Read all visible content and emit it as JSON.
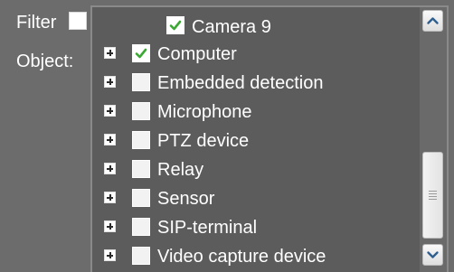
{
  "filter": {
    "label": "Filter",
    "checked": false
  },
  "object": {
    "label": "Object:"
  },
  "tree": {
    "items": [
      {
        "label": "Camera 9",
        "checked": true,
        "expandable": false
      },
      {
        "label": "Computer",
        "checked": true,
        "expandable": true
      },
      {
        "label": "Embedded detection",
        "checked": false,
        "expandable": true
      },
      {
        "label": "Microphone",
        "checked": false,
        "expandable": true
      },
      {
        "label": "PTZ device",
        "checked": false,
        "expandable": true
      },
      {
        "label": "Relay",
        "checked": false,
        "expandable": true
      },
      {
        "label": "Sensor",
        "checked": false,
        "expandable": true
      },
      {
        "label": "SIP-terminal",
        "checked": false,
        "expandable": true
      },
      {
        "label": "Video capture device",
        "checked": false,
        "expandable": true
      }
    ]
  },
  "colors": {
    "background": "#6c6c6c",
    "panel": "#5c5c5c",
    "check_green": "#3aa832",
    "text": "#ffffff"
  },
  "icons": {
    "expander": "plus-box-icon",
    "checkmark": "checkmark-icon",
    "scroll_up": "chevron-up-icon",
    "scroll_down": "chevron-down-icon"
  }
}
